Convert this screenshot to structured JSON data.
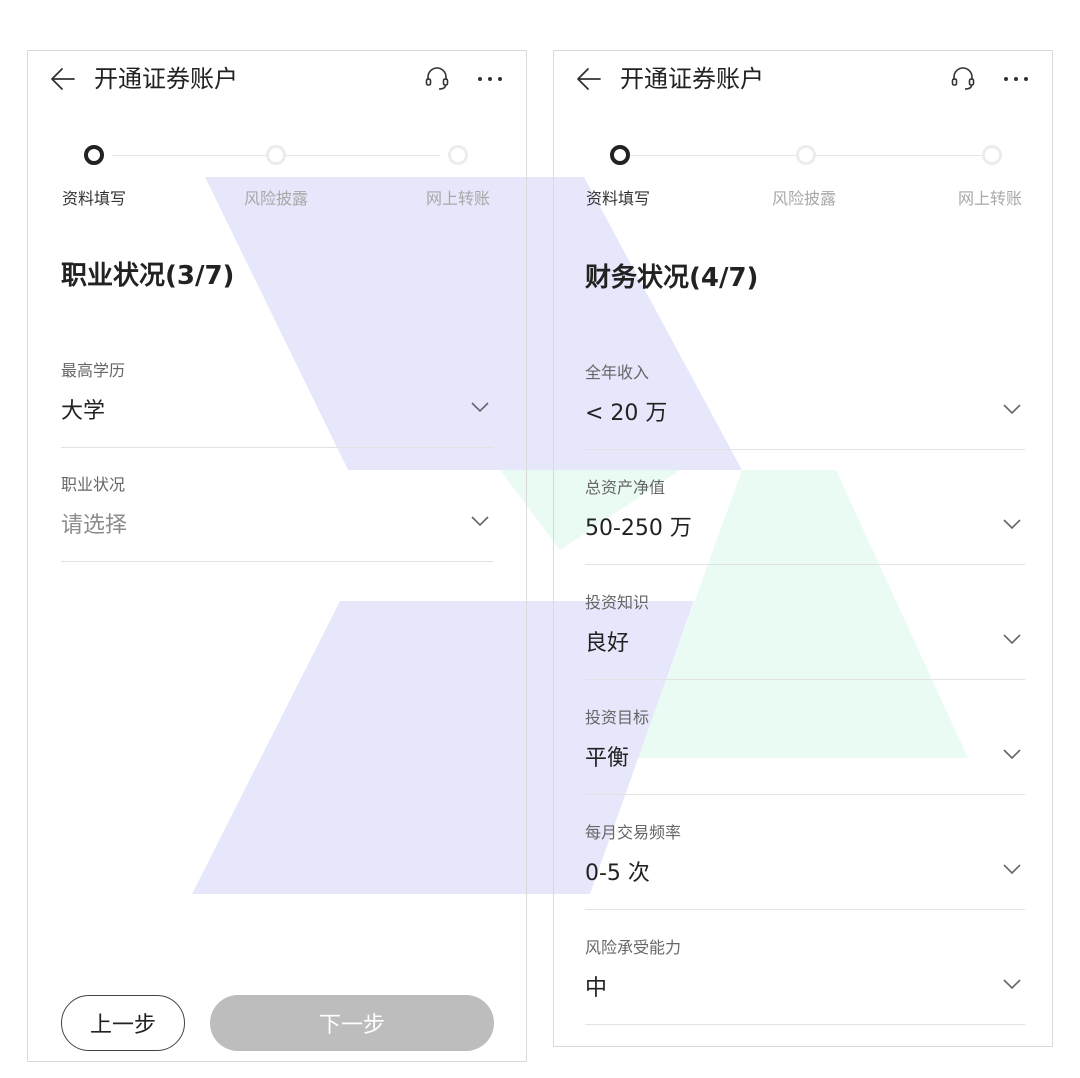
{
  "colors": {
    "accent_shape_blue": "#e6e7fb",
    "accent_shape_green": "#eafbf3",
    "step_active": "#222222",
    "step_inactive": "#ececec",
    "next_button_disabled": "#bdbdbd"
  },
  "icons": {
    "back": "arrow-left-icon",
    "service": "headset-icon",
    "more": "more-dots-icon",
    "dropdown": "chevron-down-icon"
  },
  "left_screen": {
    "header": {
      "title": "开通证券账户"
    },
    "steps": [
      {
        "label": "资料填写",
        "state": "active"
      },
      {
        "label": "风险披露",
        "state": "inactive"
      },
      {
        "label": "网上转账",
        "state": "inactive"
      }
    ],
    "section_title": "职业状况(3/7)",
    "fields": [
      {
        "label": "最高学历",
        "value": "大学"
      },
      {
        "label": "职业状况",
        "placeholder": "请选择"
      }
    ],
    "buttons": {
      "prev_label": "上一步",
      "next_label": "下一步"
    }
  },
  "right_screen": {
    "header": {
      "title": "开通证券账户"
    },
    "steps": [
      {
        "label": "资料填写",
        "state": "active"
      },
      {
        "label": "风险披露",
        "state": "inactive"
      },
      {
        "label": "网上转账",
        "state": "inactive"
      }
    ],
    "section_title": "财务状况(4/7)",
    "fields": [
      {
        "label": "全年收入",
        "value": "< 20 万"
      },
      {
        "label": "总资产净值",
        "value": "50-250 万"
      },
      {
        "label": "投资知识",
        "value": "良好"
      },
      {
        "label": "投资目标",
        "value": "平衡"
      },
      {
        "label": "每月交易频率",
        "value": "0-5 次"
      },
      {
        "label": "风险承受能力",
        "value": "中"
      }
    ]
  }
}
